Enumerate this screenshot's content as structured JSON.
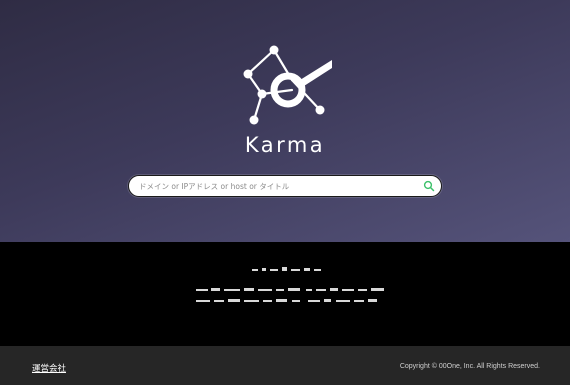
{
  "brand": {
    "name": "Karma",
    "logo_icon": "constellation-magnifier-icon",
    "text_color": "#ffffff"
  },
  "search": {
    "placeholder": "ドメイン or IPアドレス or host or タイトル",
    "value": "",
    "icon": "search-icon",
    "icon_color": "#3cc06a"
  },
  "mid_section": {
    "note": ""
  },
  "footer": {
    "company_link": "運営会社",
    "copyright": "Copyright © 00One, Inc. All Rights Reserved."
  },
  "colors": {
    "hero_top": "#2f2c44",
    "hero_bottom": "#55537a",
    "mid_bg": "#000000",
    "footer_bg": "#262626"
  }
}
